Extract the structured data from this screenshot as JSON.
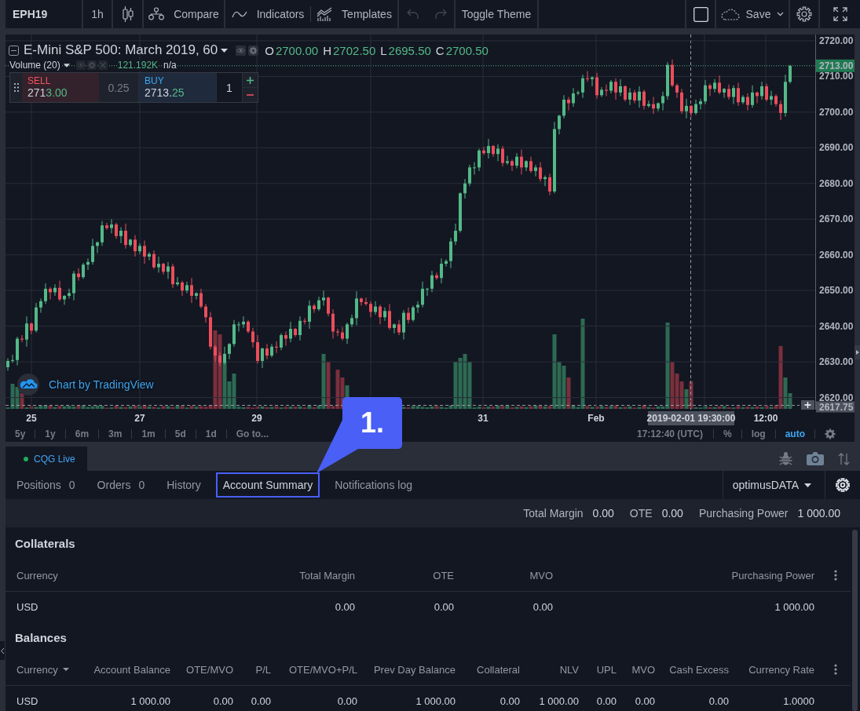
{
  "toolbar": {
    "symbol": "EPH19",
    "interval": "1h",
    "compare": "Compare",
    "indicators": "Indicators",
    "templates": "Templates",
    "undo": {
      "disabled": true
    },
    "redo": {
      "disabled": true
    },
    "toggle_theme": "Toggle Theme",
    "save": "Save"
  },
  "chart": {
    "title": "E-Mini S&P 500: March 2019, 60",
    "ohlc": [
      {
        "label": "O",
        "value": "2700.00"
      },
      {
        "label": "H",
        "value": "2702.50"
      },
      {
        "label": "L",
        "value": "2695.50"
      },
      {
        "label": "C",
        "value": "2700.50"
      }
    ],
    "volume": {
      "label": "Volume (20)",
      "value": "121.192K",
      "extra": "n/a"
    },
    "order_panel": {
      "sell": {
        "label": "SELL",
        "price_main": "271",
        "price_accent": "3.00"
      },
      "spread": "0.25",
      "buy": {
        "label": "BUY",
        "price_main": "2713.",
        "price_accent": "25"
      },
      "quantity": "1"
    },
    "last_price": "2713.00",
    "crosshair": {
      "price": "2617.75",
      "time": "2019-02-01 19:30:00"
    },
    "attribution": "Chart by TradingView",
    "time_axis": [
      "25",
      "27",
      "29",
      "31",
      "Feb",
      "12:00"
    ],
    "chart_data": {
      "type": "candlestick",
      "grid": true,
      "ylim": [
        2616.6,
        2721.75
      ],
      "yticks": [
        {
          "value": 2720,
          "label": "2720.00"
        },
        {
          "value": 2710,
          "label": "2710.00"
        },
        {
          "value": 2700,
          "label": "2700.00"
        },
        {
          "value": 2690,
          "label": "2690.00"
        },
        {
          "value": 2680,
          "label": "2680.00"
        },
        {
          "value": 2670,
          "label": "2670.00"
        },
        {
          "value": 2660,
          "label": "2660.00"
        },
        {
          "value": 2650,
          "label": "2650.00"
        },
        {
          "value": 2640,
          "label": "2640.00"
        },
        {
          "value": 2630,
          "label": "2630.00"
        },
        {
          "value": 2620,
          "label": "2620.00"
        }
      ],
      "ohlc": [
        [
          2628.5,
          2631,
          2627.5,
          2630.25
        ],
        [
          2630.25,
          2632,
          2629.75,
          2630.5
        ],
        [
          2630.5,
          2637,
          2629,
          2636.5
        ],
        [
          2636.5,
          2637.5,
          2635.5,
          2636.25
        ],
        [
          2636.25,
          2642.75,
          2634.25,
          2640.75
        ],
        [
          2640.75,
          2641,
          2637.75,
          2638.75
        ],
        [
          2638.75,
          2646.5,
          2638.25,
          2645.25
        ],
        [
          2645.25,
          2647.75,
          2643.75,
          2647
        ],
        [
          2647,
          2652,
          2646.25,
          2650.5
        ],
        [
          2650.5,
          2651,
          2647.5,
          2649.5
        ],
        [
          2649.5,
          2651.75,
          2648.5,
          2650.75
        ],
        [
          2650.75,
          2652.75,
          2647,
          2647.5
        ],
        [
          2647.5,
          2648.75,
          2646,
          2648.5
        ],
        [
          2648.5,
          2650.5,
          2647.75,
          2649.25
        ],
        [
          2649.25,
          2655.5,
          2647.25,
          2654.75
        ],
        [
          2654.75,
          2656.25,
          2652.75,
          2653.75
        ],
        [
          2653.75,
          2657.75,
          2653.25,
          2657.25
        ],
        [
          2657.25,
          2659,
          2655.75,
          2658
        ],
        [
          2658,
          2664.5,
          2657.25,
          2662.5
        ],
        [
          2662.5,
          2663.75,
          2660.5,
          2663.5
        ],
        [
          2663.5,
          2669.5,
          2662.5,
          2668.25
        ],
        [
          2668.25,
          2669,
          2667,
          2667.5
        ],
        [
          2667.5,
          2670,
          2666,
          2668.5
        ],
        [
          2668.5,
          2669,
          2664.5,
          2665.25
        ],
        [
          2665.25,
          2667.75,
          2663.25,
          2666.75
        ],
        [
          2666.75,
          2668.75,
          2661.75,
          2662.75
        ],
        [
          2662.75,
          2664.5,
          2662.25,
          2664.25
        ],
        [
          2664.25,
          2665.5,
          2659.5,
          2661
        ],
        [
          2661,
          2663.25,
          2660.25,
          2662.5
        ],
        [
          2662.5,
          2664,
          2657.5,
          2659.5
        ],
        [
          2659.5,
          2660.75,
          2658.5,
          2660.25
        ],
        [
          2660.25,
          2661.25,
          2656,
          2656.5
        ],
        [
          2656.5,
          2659.5,
          2655,
          2657.5
        ],
        [
          2657.5,
          2657.75,
          2654.5,
          2655.25
        ],
        [
          2655.25,
          2658,
          2653.25,
          2656.75
        ],
        [
          2656.75,
          2657.5,
          2650.75,
          2651.75
        ],
        [
          2651.75,
          2653.75,
          2651.25,
          2652.25
        ],
        [
          2652.25,
          2652.75,
          2648.5,
          2650
        ],
        [
          2650,
          2652.5,
          2649.25,
          2651.5
        ],
        [
          2651.5,
          2653.5,
          2646.5,
          2648.5
        ],
        [
          2648.5,
          2649.5,
          2647.5,
          2649.25
        ],
        [
          2649.25,
          2650.5,
          2645,
          2645.5
        ],
        [
          2645.5,
          2646.25,
          2641,
          2642.5
        ],
        [
          2642.5,
          2644,
          2633.5,
          2634.25
        ],
        [
          2634.25,
          2634.75,
          2629.75,
          2631.75
        ],
        [
          2631.75,
          2632.75,
          2628.75,
          2629.75
        ],
        [
          2629.75,
          2634.25,
          2629.25,
          2632.25
        ],
        [
          2632.25,
          2635.25,
          2630.75,
          2635
        ],
        [
          2635,
          2641.75,
          2634.25,
          2640.5
        ],
        [
          2640.5,
          2641.25,
          2638.5,
          2640.5
        ],
        [
          2640.5,
          2642.75,
          2639.5,
          2641.25
        ],
        [
          2641.25,
          2641.75,
          2638,
          2638.5
        ],
        [
          2638.5,
          2639.5,
          2634,
          2635.5
        ],
        [
          2635.5,
          2637.5,
          2629.5,
          2630.25
        ],
        [
          2630.25,
          2634,
          2628.25,
          2633.75
        ],
        [
          2633.75,
          2635,
          2630.75,
          2631.75
        ],
        [
          2631.75,
          2635,
          2631.25,
          2634.25
        ],
        [
          2634.25,
          2635.75,
          2632.5,
          2634
        ],
        [
          2634,
          2638,
          2633.25,
          2637.5
        ],
        [
          2637.5,
          2638.5,
          2634.5,
          2636.5
        ],
        [
          2636.5,
          2641.25,
          2635.5,
          2639.25
        ],
        [
          2639.25,
          2639.5,
          2637,
          2637.5
        ],
        [
          2637.5,
          2642.75,
          2636,
          2641.5
        ],
        [
          2641.5,
          2642.25,
          2640.5,
          2641.25
        ],
        [
          2641.25,
          2647.25,
          2639.25,
          2645.75
        ],
        [
          2645.75,
          2646.25,
          2643.75,
          2644.75
        ],
        [
          2644.75,
          2648.25,
          2644.25,
          2647.25
        ],
        [
          2647.25,
          2650,
          2645.75,
          2648
        ],
        [
          2648,
          2648.25,
          2642.75,
          2643.5
        ],
        [
          2643.5,
          2644.75,
          2636.5,
          2638.5
        ],
        [
          2638.5,
          2639.25,
          2637.25,
          2638.25
        ],
        [
          2638.25,
          2639.75,
          2636,
          2636.5
        ],
        [
          2636.5,
          2641,
          2635,
          2640.5
        ],
        [
          2640.5,
          2643.25,
          2639.75,
          2642.25
        ],
        [
          2642.25,
          2649.75,
          2640.25,
          2647.75
        ],
        [
          2647.75,
          2648,
          2645.75,
          2646.75
        ],
        [
          2646.75,
          2648,
          2645.75,
          2646.25
        ],
        [
          2646.25,
          2647,
          2642.5,
          2644
        ],
        [
          2644,
          2647,
          2643.25,
          2645.5
        ],
        [
          2645.5,
          2646,
          2640.5,
          2642.5
        ],
        [
          2642.5,
          2645.25,
          2641.5,
          2644.25
        ],
        [
          2644.25,
          2646.25,
          2639,
          2639.5
        ],
        [
          2639.5,
          2640.75,
          2638,
          2640.5
        ],
        [
          2640.5,
          2641.75,
          2637.5,
          2638.25
        ],
        [
          2638.25,
          2644.5,
          2636.25,
          2643.75
        ],
        [
          2643.75,
          2645.25,
          2640.75,
          2641.75
        ],
        [
          2641.75,
          2645.75,
          2641.25,
          2645.25
        ],
        [
          2645.25,
          2647,
          2643.75,
          2646
        ],
        [
          2646,
          2652.5,
          2645.25,
          2650.5
        ],
        [
          2650.5,
          2650.75,
          2648.5,
          2650.5
        ],
        [
          2650.5,
          2655.5,
          2649.5,
          2654.25
        ],
        [
          2654.25,
          2655,
          2653,
          2653.5
        ],
        [
          2653.5,
          2659,
          2652,
          2657.5
        ],
        [
          2657.5,
          2658.75,
          2656.75,
          2658.25
        ],
        [
          2658.25,
          2664.75,
          2656.25,
          2663.75
        ],
        [
          2663.75,
          2668.75,
          2662.75,
          2666.75
        ],
        [
          2666.75,
          2677.5,
          2666.25,
          2677.25
        ],
        [
          2677.25,
          2681.25,
          2675.75,
          2680
        ],
        [
          2680,
          2685.25,
          2679.25,
          2684.5
        ],
        [
          2684.5,
          2686,
          2682.5,
          2684.5
        ],
        [
          2684.5,
          2689.75,
          2683.5,
          2689.25
        ],
        [
          2689.25,
          2690.25,
          2688,
          2688.5
        ],
        [
          2688.5,
          2692.5,
          2687,
          2690.5
        ],
        [
          2690.5,
          2690.75,
          2687.5,
          2688.25
        ],
        [
          2688.25,
          2691,
          2686.25,
          2689.75
        ],
        [
          2689.75,
          2690.5,
          2684.75,
          2685.75
        ],
        [
          2685.75,
          2687.75,
          2685.25,
          2686.25
        ],
        [
          2686.25,
          2686.75,
          2683.5,
          2685
        ],
        [
          2685,
          2688.5,
          2684.25,
          2687.5
        ],
        [
          2687.5,
          2689.5,
          2682.5,
          2684.5
        ],
        [
          2684.5,
          2686.5,
          2683.5,
          2686.25
        ],
        [
          2686.25,
          2687.5,
          2683,
          2683.5
        ],
        [
          2683.5,
          2685.25,
          2682,
          2684.5
        ],
        [
          2684.5,
          2686,
          2680.5,
          2681.25
        ],
        [
          2681.25,
          2682.25,
          2679.25,
          2681.75
        ],
        [
          2681.75,
          2682.75,
          2676.75,
          2677.75
        ],
        [
          2677.75,
          2697.25,
          2677.25,
          2695.25
        ],
        [
          2695.25,
          2699.25,
          2693.75,
          2699
        ],
        [
          2699,
          2704.75,
          2698.25,
          2703.5
        ],
        [
          2703.5,
          2704.25,
          2700.5,
          2702.5
        ],
        [
          2702.5,
          2706.75,
          2701.5,
          2705.25
        ],
        [
          2705.25,
          2706,
          2704.75,
          2705.5
        ],
        [
          2705.5,
          2710.5,
          2704,
          2709.5
        ],
        [
          2709.5,
          2711.5,
          2708.5,
          2709.25
        ],
        [
          2709.25,
          2710,
          2707.25,
          2709.75
        ],
        [
          2709.75,
          2711,
          2703.75,
          2704.75
        ],
        [
          2704.75,
          2707,
          2704.25,
          2706.25
        ],
        [
          2706.25,
          2707.75,
          2704.5,
          2706
        ],
        [
          2706,
          2709,
          2705.25,
          2708.5
        ],
        [
          2708.5,
          2709.5,
          2703.5,
          2705.5
        ],
        [
          2705.5,
          2709.25,
          2704.5,
          2707.25
        ],
        [
          2707.25,
          2707.5,
          2703,
          2703.5
        ],
        [
          2703.5,
          2706.75,
          2702,
          2705.5
        ],
        [
          2705.5,
          2706.25,
          2702.5,
          2703.25
        ],
        [
          2703.25,
          2707.25,
          2701.25,
          2705.75
        ],
        [
          2705.75,
          2706.25,
          2700.75,
          2701.75
        ],
        [
          2701.75,
          2703.25,
          2701.25,
          2702.25
        ],
        [
          2702.25,
          2704.25,
          2699.5,
          2701
        ],
        [
          2701,
          2702.75,
          2700.25,
          2702.5
        ],
        [
          2702.5,
          2705.75,
          2700.5,
          2704.5
        ],
        [
          2704.5,
          2714,
          2703.5,
          2713.25
        ],
        [
          2713.25,
          2714.75,
          2707,
          2707.5
        ],
        [
          2707.5,
          2708,
          2704,
          2705.5
        ],
        [
          2705.5,
          2706.5,
          2699.5,
          2700.25
        ],
        [
          2700.25,
          2703.75,
          2698.25,
          2701.75
        ],
        [
          2701.75,
          2702,
          2698.75,
          2699.75
        ],
        [
          2699.75,
          2703.5,
          2699.25,
          2702.25
        ],
        [
          2702.25,
          2703.75,
          2700.75,
          2703
        ],
        [
          2703,
          2709,
          2702.25,
          2707.5
        ],
        [
          2707.5,
          2708,
          2704.5,
          2706.5
        ],
        [
          2706.5,
          2709.25,
          2705.5,
          2708.25
        ],
        [
          2708.25,
          2710.25,
          2705,
          2705.5
        ],
        [
          2705.5,
          2706.75,
          2704,
          2706.5
        ],
        [
          2706.5,
          2707.75,
          2703.5,
          2704.25
        ],
        [
          2704.25,
          2707.5,
          2702.25,
          2706.75
        ],
        [
          2706.75,
          2708.25,
          2701.75,
          2702.75
        ],
        [
          2702.75,
          2704.75,
          2702.25,
          2704.25
        ],
        [
          2704.25,
          2705.25,
          2700.5,
          2702
        ],
        [
          2702,
          2707.5,
          2701.25,
          2705.5
        ],
        [
          2705.5,
          2705.75,
          2702.5,
          2704.5
        ],
        [
          2704.5,
          2708.5,
          2703.5,
          2707.25
        ],
        [
          2707.25,
          2708,
          2703,
          2703.5
        ],
        [
          2703.5,
          2706,
          2702,
          2704.5
        ],
        [
          2704.5,
          2705,
          2701.5,
          2702.25
        ],
        [
          2702.25,
          2703.25,
          2697.75,
          2699.75
        ],
        [
          2699.75,
          2710.5,
          2698.75,
          2708.5
        ],
        [
          2708.5,
          2713.25,
          2708,
          2713
        ]
      ]
    }
  },
  "range_bar": {
    "ranges": [
      "5y",
      "1y",
      "6m",
      "3m",
      "1m",
      "5d",
      "1d"
    ],
    "goto": "Go to...",
    "clock": "17:12:40",
    "timezone": "(UTC)",
    "scale_options": [
      {
        "label": "%",
        "selected": false
      },
      {
        "label": "log",
        "selected": false
      },
      {
        "label": "auto",
        "selected": true
      }
    ]
  },
  "account_panel": {
    "broker": {
      "label": "CQG Live",
      "connected": true
    },
    "tabs": [
      {
        "label": "Positions",
        "count": "0",
        "selected": false,
        "highlighted": false
      },
      {
        "label": "Orders",
        "count": "0",
        "selected": false,
        "highlighted": false
      },
      {
        "label": "History",
        "selected": false,
        "highlighted": false
      },
      {
        "label": "Account Summary",
        "selected": true,
        "highlighted": true
      },
      {
        "label": "Notifications log",
        "selected": false,
        "highlighted": false
      }
    ],
    "account": "optimusDATA",
    "summary": [
      {
        "label": "Total Margin",
        "value": "0.00"
      },
      {
        "label": "OTE",
        "value": "0.00"
      },
      {
        "label": "Purchasing Power",
        "value": "1 000.00"
      }
    ],
    "sections": [
      {
        "title": "Collaterals",
        "columns": [
          {
            "label": "Currency",
            "dropdown": false
          },
          {
            "label": "Total Margin",
            "dropdown": false
          },
          {
            "label": "OTE",
            "dropdown": false
          },
          {
            "label": "MVO",
            "dropdown": false
          },
          {
            "label": "Purchasing Power",
            "dropdown": false
          }
        ],
        "rows": [
          [
            "USD",
            "0.00",
            "0.00",
            "0.00",
            "1 000.00"
          ]
        ]
      },
      {
        "title": "Balances",
        "columns": [
          {
            "label": "Currency",
            "dropdown": true
          },
          {
            "label": "Account Balance",
            "dropdown": false
          },
          {
            "label": "OTE/MVO",
            "dropdown": false
          },
          {
            "label": "P/L",
            "dropdown": false
          },
          {
            "label": "OTE/MVO+P/L",
            "dropdown": false
          },
          {
            "label": "Prev Day Balance",
            "dropdown": false
          },
          {
            "label": "Collateral",
            "dropdown": false
          },
          {
            "label": "NLV",
            "dropdown": false
          },
          {
            "label": "UPL",
            "dropdown": false
          },
          {
            "label": "MVO",
            "dropdown": false
          },
          {
            "label": "Cash Excess",
            "dropdown": false
          },
          {
            "label": "Currency Rate",
            "dropdown": false
          }
        ],
        "rows": [
          [
            "USD",
            "1 000.00",
            "0.00",
            "0.00",
            "0.00",
            "1 000.00",
            "0.00",
            "1 000.00",
            "0.00",
            "0.00",
            "0.00",
            "1.0000"
          ]
        ]
      }
    ]
  },
  "annotation": {
    "label": "1."
  }
}
